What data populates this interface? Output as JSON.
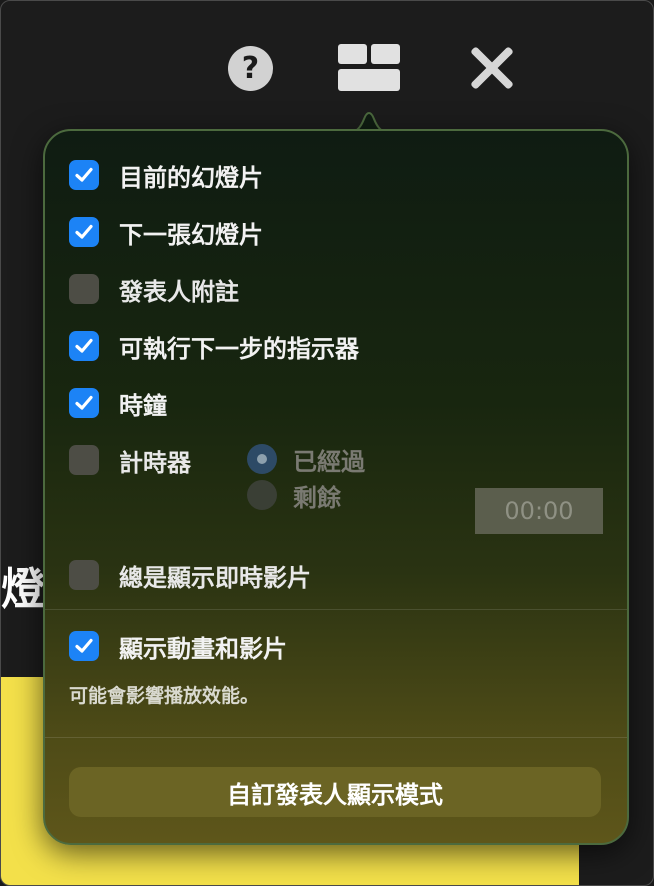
{
  "background": {
    "slide_text": "燈"
  },
  "toolbar": {
    "help_icon": "question-mark-icon",
    "layout_icon": "layout-grid-icon",
    "close_icon": "close-icon"
  },
  "popover": {
    "options": [
      {
        "label": "目前的幻燈片",
        "checked": true
      },
      {
        "label": "下一張幻燈片",
        "checked": true
      },
      {
        "label": "發表人附註",
        "checked": false
      },
      {
        "label": "可執行下一步的指示器",
        "checked": true
      },
      {
        "label": "時鐘",
        "checked": true
      },
      {
        "label": "計時器",
        "checked": false
      }
    ],
    "timer": {
      "mode_elapsed": "已經過",
      "mode_remaining": "剩餘",
      "selected": "已經過",
      "value": "00:00"
    },
    "always_show_live_video": {
      "label": "總是顯示即時影片",
      "checked": false
    },
    "show_animations": {
      "label": "顯示動畫和影片",
      "checked": true
    },
    "note": "可能會影響播放效能。",
    "custom_button": "自訂發表人顯示模式"
  },
  "colors": {
    "accent": "#1c83f6",
    "slide_yellow": "#f3e04a"
  }
}
